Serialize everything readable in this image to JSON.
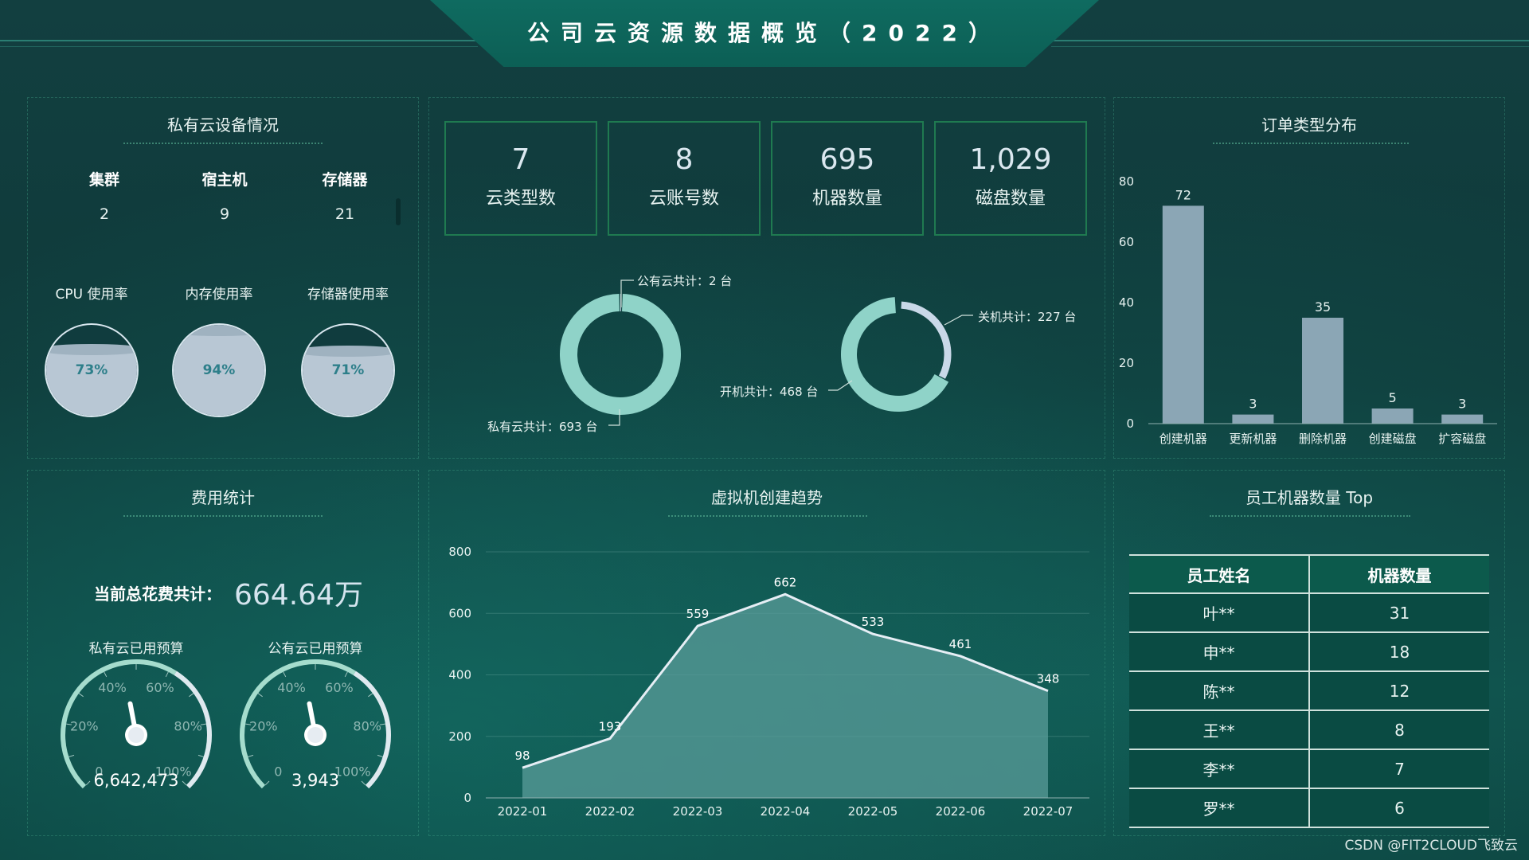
{
  "header": {
    "title": "公司云资源数据概览（2022）"
  },
  "private_cloud": {
    "title": "私有云设备情况",
    "stats": [
      {
        "label": "集群",
        "value": "2"
      },
      {
        "label": "宿主机",
        "value": "9"
      },
      {
        "label": "存储器",
        "value": "21"
      }
    ],
    "usage": [
      {
        "label": "CPU 使用率",
        "text": "73%",
        "level": 0.73
      },
      {
        "label": "内存使用率",
        "text": "94%",
        "level": 0.94
      },
      {
        "label": "存储器使用率",
        "text": "71%",
        "level": 0.71
      }
    ]
  },
  "summary": {
    "boxes": [
      {
        "value": "7",
        "label": "云类型数"
      },
      {
        "value": "8",
        "label": "云账号数"
      },
      {
        "value": "695",
        "label": "机器数量"
      },
      {
        "value": "1,029",
        "label": "磁盘数量"
      }
    ],
    "cloud_donut": {
      "public_label": "公有云共计：2 台",
      "private_label": "私有云共计：693 台",
      "public": 2,
      "private": 693
    },
    "power_donut": {
      "off_label": "关机共计：227 台",
      "on_label": "开机共计：468 台",
      "off": 227,
      "on": 468
    },
    "colors": {
      "donut_main": "#8fd3c8",
      "donut_minor": "#c9d8e8"
    }
  },
  "orders": {
    "title": "订单类型分布"
  },
  "cost": {
    "title": "费用统计",
    "total_label": "当前总花费共计：",
    "total_value": "664.64万",
    "gauges": [
      {
        "title": "私有云已用预算",
        "value_text": "6,642,473",
        "ratio": 0.46,
        "ticks": [
          "20%",
          "40%",
          "60%",
          "80%",
          "100%"
        ],
        "zero": "0"
      },
      {
        "title": "公有云已用预算",
        "value_text": "3,943",
        "ratio": 0.46,
        "ticks": [
          "20%",
          "40%",
          "60%",
          "80%",
          "100%"
        ],
        "zero": "0"
      }
    ]
  },
  "trend": {
    "title": "虚拟机创建趋势"
  },
  "employees": {
    "title": "员工机器数量 Top",
    "headers": [
      "员工姓名",
      "机器数量"
    ],
    "rows": [
      [
        "叶**",
        "31"
      ],
      [
        "申**",
        "18"
      ],
      [
        "陈**",
        "12"
      ],
      [
        "王**",
        "8"
      ],
      [
        "李**",
        "7"
      ],
      [
        "罗**",
        "6"
      ]
    ]
  },
  "chart_data": [
    {
      "type": "bar",
      "title": "订单类型分布",
      "categories": [
        "创建机器",
        "更新机器",
        "删除机器",
        "创建磁盘",
        "扩容磁盘"
      ],
      "values": [
        72,
        3,
        35,
        5,
        3
      ],
      "ylim": [
        0,
        80
      ],
      "yticks": [
        "0",
        "20",
        "40",
        "60",
        "80"
      ],
      "color": "#8ba6b5"
    },
    {
      "type": "area",
      "title": "虚拟机创建趋势",
      "categories": [
        "2022-01",
        "2022-02",
        "2022-03",
        "2022-04",
        "2022-05",
        "2022-06",
        "2022-07"
      ],
      "values": [
        98,
        193,
        559,
        662,
        533,
        461,
        348
      ],
      "ylim": [
        0,
        800
      ],
      "yticks": [
        "0",
        "200",
        "400",
        "600",
        "800"
      ],
      "color": "#5a9c9a"
    }
  ],
  "watermark": "CSDN @FIT2CLOUD飞致云"
}
